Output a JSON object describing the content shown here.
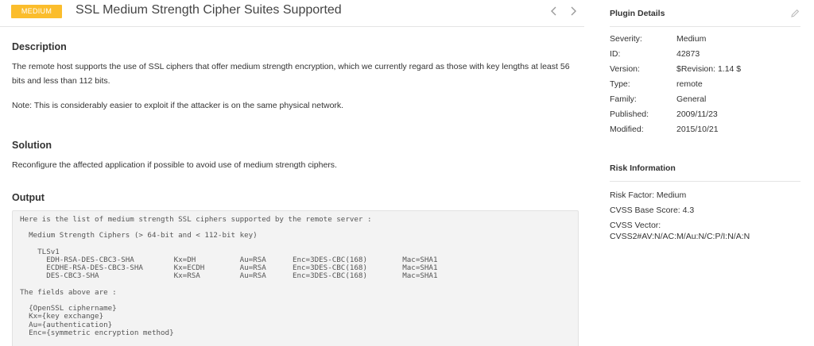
{
  "header": {
    "severity_badge": "MEDIUM",
    "title": "SSL Medium Strength Cipher Suites Supported",
    "prev_icon": "chevron-left-icon",
    "next_icon": "chevron-right-icon",
    "badge_color": "#fbbd2c"
  },
  "description": {
    "heading": "Description",
    "text": "The remote host supports the use of SSL ciphers that offer medium strength encryption, which we currently regard as those with key lengths at least 56 bits and less than 112 bits.",
    "note": "Note: This is considerably easier to exploit if the attacker is on the same physical network."
  },
  "solution": {
    "heading": "Solution",
    "text": "Reconfigure the affected application if possible to avoid use of medium strength ciphers."
  },
  "output": {
    "heading": "Output",
    "text": "Here is the list of medium strength SSL ciphers supported by the remote server :\n\n  Medium Strength Ciphers (> 64-bit and < 112-bit key)\n\n    TLSv1\n      EDH-RSA-DES-CBC3-SHA         Kx=DH          Au=RSA      Enc=3DES-CBC(168)        Mac=SHA1\n      ECDHE-RSA-DES-CBC3-SHA       Kx=ECDH        Au=RSA      Enc=3DES-CBC(168)        Mac=SHA1\n      DES-CBC3-SHA                 Kx=RSA         Au=RSA      Enc=3DES-CBC(168)        Mac=SHA1\n\nThe fields above are :\n\n  {OpenSSL ciphername}\n  Kx={key exchange}\n  Au={authentication}\n  Enc={symmetric encryption method}"
  },
  "plugin_details": {
    "heading": "Plugin Details",
    "edit_icon": "pencil-icon",
    "rows": [
      {
        "label": "Severity:",
        "value": "Medium"
      },
      {
        "label": "ID:",
        "value": "42873"
      },
      {
        "label": "Version:",
        "value": "$Revision: 1.14 $"
      },
      {
        "label": "Type:",
        "value": "remote"
      },
      {
        "label": "Family:",
        "value": "General"
      },
      {
        "label": "Published:",
        "value": "2009/11/23"
      },
      {
        "label": "Modified:",
        "value": "2015/10/21"
      }
    ]
  },
  "risk_information": {
    "heading": "Risk Information",
    "risk_factor": "Risk Factor:  Medium",
    "cvss_base_score": "CVSS Base Score:  4.3",
    "cvss_vector": "CVSS Vector:  CVSS2#AV:N/AC:M/Au:N/C:P/I:N/A:N"
  }
}
